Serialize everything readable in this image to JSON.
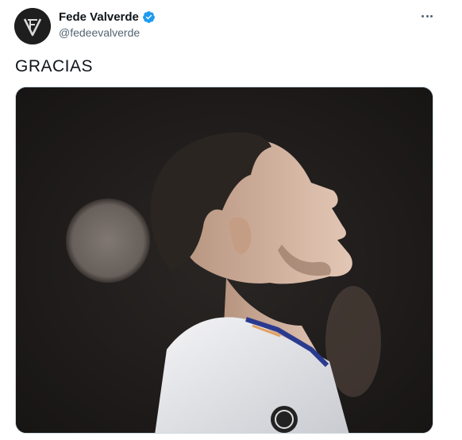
{
  "tweet": {
    "author": {
      "display_name": "Fede Valverde",
      "handle": "@fedeevalverde",
      "verified": true,
      "avatar_icon": "fv-monogram-logo"
    },
    "text": "GRACIAS",
    "media": {
      "type": "photo",
      "description_icon": "player-looking-up-photo"
    },
    "more_icon": "more-horizontal-icon"
  },
  "colors": {
    "verified_blue": "#1d9bf0",
    "text_primary": "#0f1419",
    "text_secondary": "#536471"
  }
}
